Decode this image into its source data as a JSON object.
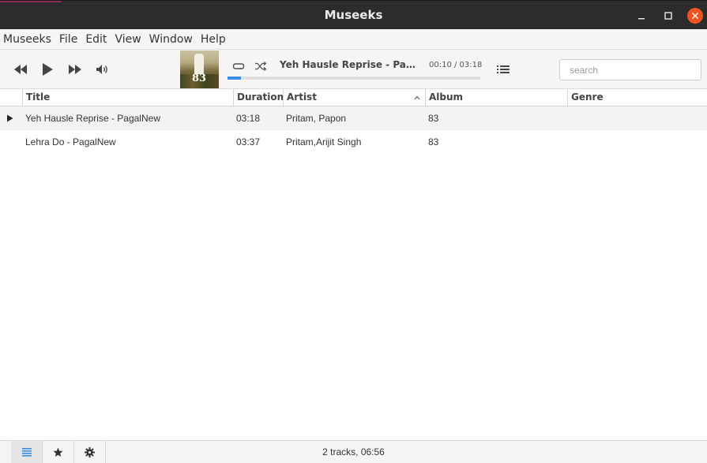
{
  "window": {
    "title": "Museeks"
  },
  "menu": [
    "Museeks",
    "File",
    "Edit",
    "View",
    "Window",
    "Help"
  ],
  "player": {
    "now_playing": "Yeh Hausle Reprise - PagalNew",
    "time": "00:10 / 03:18",
    "progress": 0.0524,
    "cover_text": "83"
  },
  "search": {
    "placeholder": "search",
    "value": ""
  },
  "table": {
    "columns": [
      "Title",
      "Duration",
      "Artist",
      "Album",
      "Genre"
    ],
    "sort_indicator": "^",
    "rows": [
      {
        "title": "Yeh Hausle Reprise - PagalNew",
        "duration": "03:18",
        "artist": "Pritam, Papon",
        "album": "83",
        "genre": ""
      },
      {
        "title": "Lehra Do - PagalNew",
        "duration": "03:37",
        "artist": "Pritam,Arijit Singh",
        "album": "83",
        "genre": ""
      }
    ]
  },
  "footer": {
    "status": "2 tracks, 06:56"
  },
  "colors": {
    "accent": "#3a8de0",
    "close": "#e95420",
    "titlebar": "#2c2c2c"
  }
}
